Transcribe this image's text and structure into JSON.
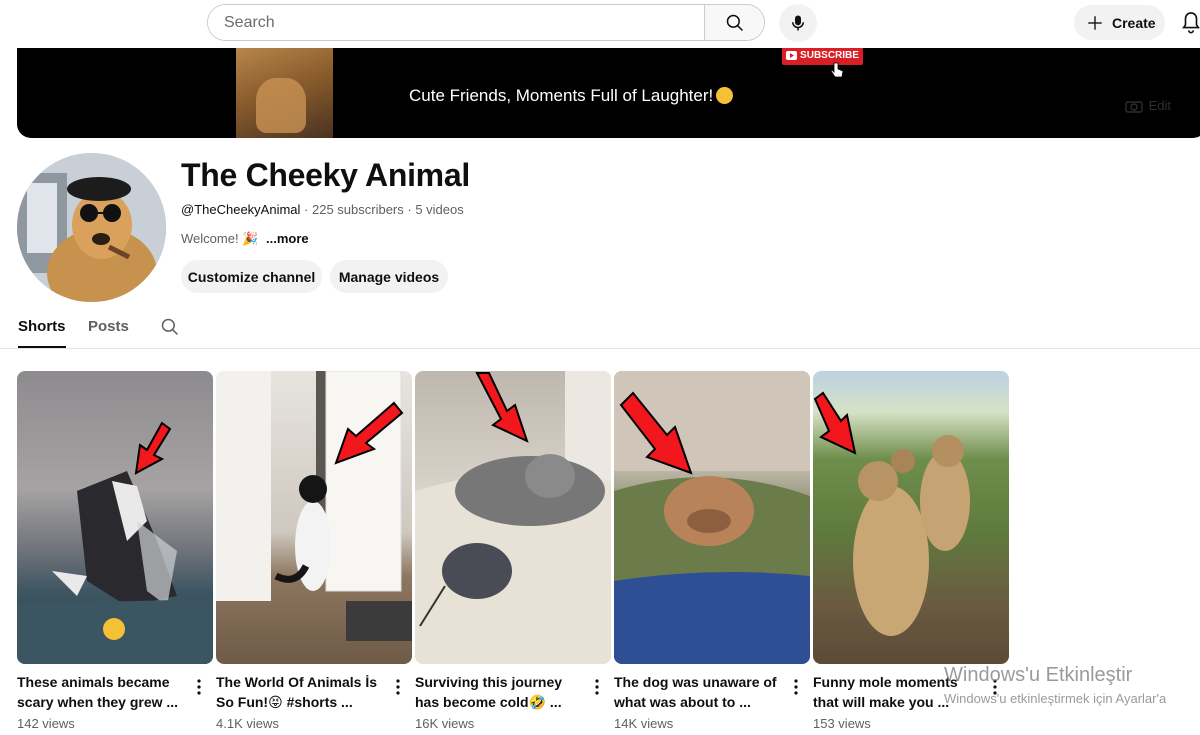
{
  "header": {
    "search_placeholder": "Search",
    "create_label": "Create",
    "icons": [
      "search-icon",
      "mic-icon",
      "plus-icon",
      "bell-icon"
    ]
  },
  "banner": {
    "subscribe_label": "SUBSCRIBE",
    "tagline": "Cute Friends, Moments Full of Laughter!",
    "edit_label": "Edit"
  },
  "channel": {
    "name": "The Cheeky Animal",
    "handle": "@TheCheekyAnimal",
    "subscribers": "225 subscribers",
    "video_count": "5 videos",
    "separator": " · ",
    "description": "Welcome! 🎉",
    "more_label": "...more",
    "customize_label": "Customize channel",
    "manage_label": "Manage videos"
  },
  "tabs": [
    {
      "label": "Shorts",
      "active": true
    },
    {
      "label": "Posts",
      "active": false
    }
  ],
  "shorts": [
    {
      "title": "These animals became scary when they grew ...",
      "views": "142 views"
    },
    {
      "title": "The World Of Animals İs So Fun!😝 #shorts ...",
      "views": "4.1K views"
    },
    {
      "title": "Surviving this journey has become cold🤣 ...",
      "views": "16K views"
    },
    {
      "title": "The dog was unaware of what was about to ...",
      "views": "14K views"
    },
    {
      "title": "Funny mole moments that will make you ...",
      "views": "153 views"
    }
  ],
  "watermark": {
    "line1": "Windows'u Etkinleştir",
    "line2": "Windows'u etkinleştirmek için Ayarlar'a"
  },
  "colors": {
    "accent_red": "#d81f26",
    "text_primary": "#0f0f0f",
    "text_secondary": "#606060",
    "pill_bg": "#f2f2f2"
  }
}
